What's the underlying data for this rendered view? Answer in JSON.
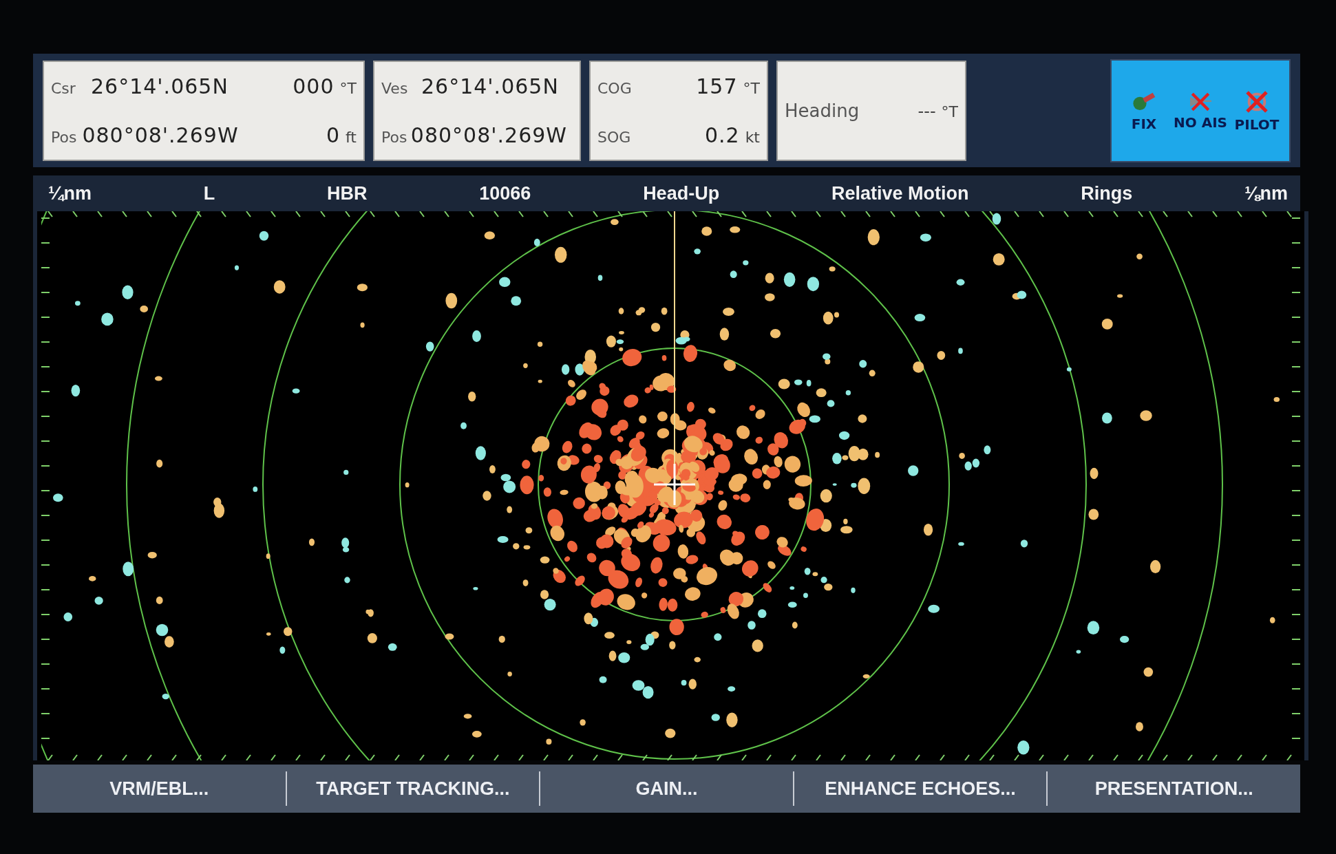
{
  "readouts": [
    {
      "kind": "dual",
      "label": "Csr",
      "sub_label": "Pos",
      "lat": "26°14'.065N",
      "lon": "080°08'.269W",
      "value_1": "000",
      "unit_1": "°T",
      "value_2": "0",
      "unit_2": "ft"
    },
    {
      "kind": "dual",
      "label": "Ves",
      "sub_label": "Pos",
      "lat": "26°14'.065N",
      "lon": "080°08'.269W"
    },
    {
      "kind": "pair",
      "label": "COG",
      "sub_label": "SOG",
      "value_1": "157",
      "unit_1": "°T",
      "value_2": "0.2",
      "unit_2": "kt"
    },
    {
      "kind": "single",
      "label": "Heading",
      "value_1": "---",
      "unit_1": "°T"
    }
  ],
  "indicators": [
    {
      "kind": "fix",
      "label": "FIX",
      "crossed": false
    },
    {
      "kind": "ais",
      "label": "NO AIS",
      "crossed": true
    },
    {
      "kind": "pilot",
      "label": "PILOT",
      "crossed": true
    }
  ],
  "status_bar": [
    "¼nm",
    "L",
    "HBR",
    "10066",
    "Head-Up",
    "Relative Motion",
    "Rings",
    "⅛nm"
  ],
  "softkeys": [
    "VRM/EBL...",
    "TARGET TRACKING...",
    "GAIN...",
    "ENHANCE ECHOES...",
    "PRESENTATION..."
  ]
}
